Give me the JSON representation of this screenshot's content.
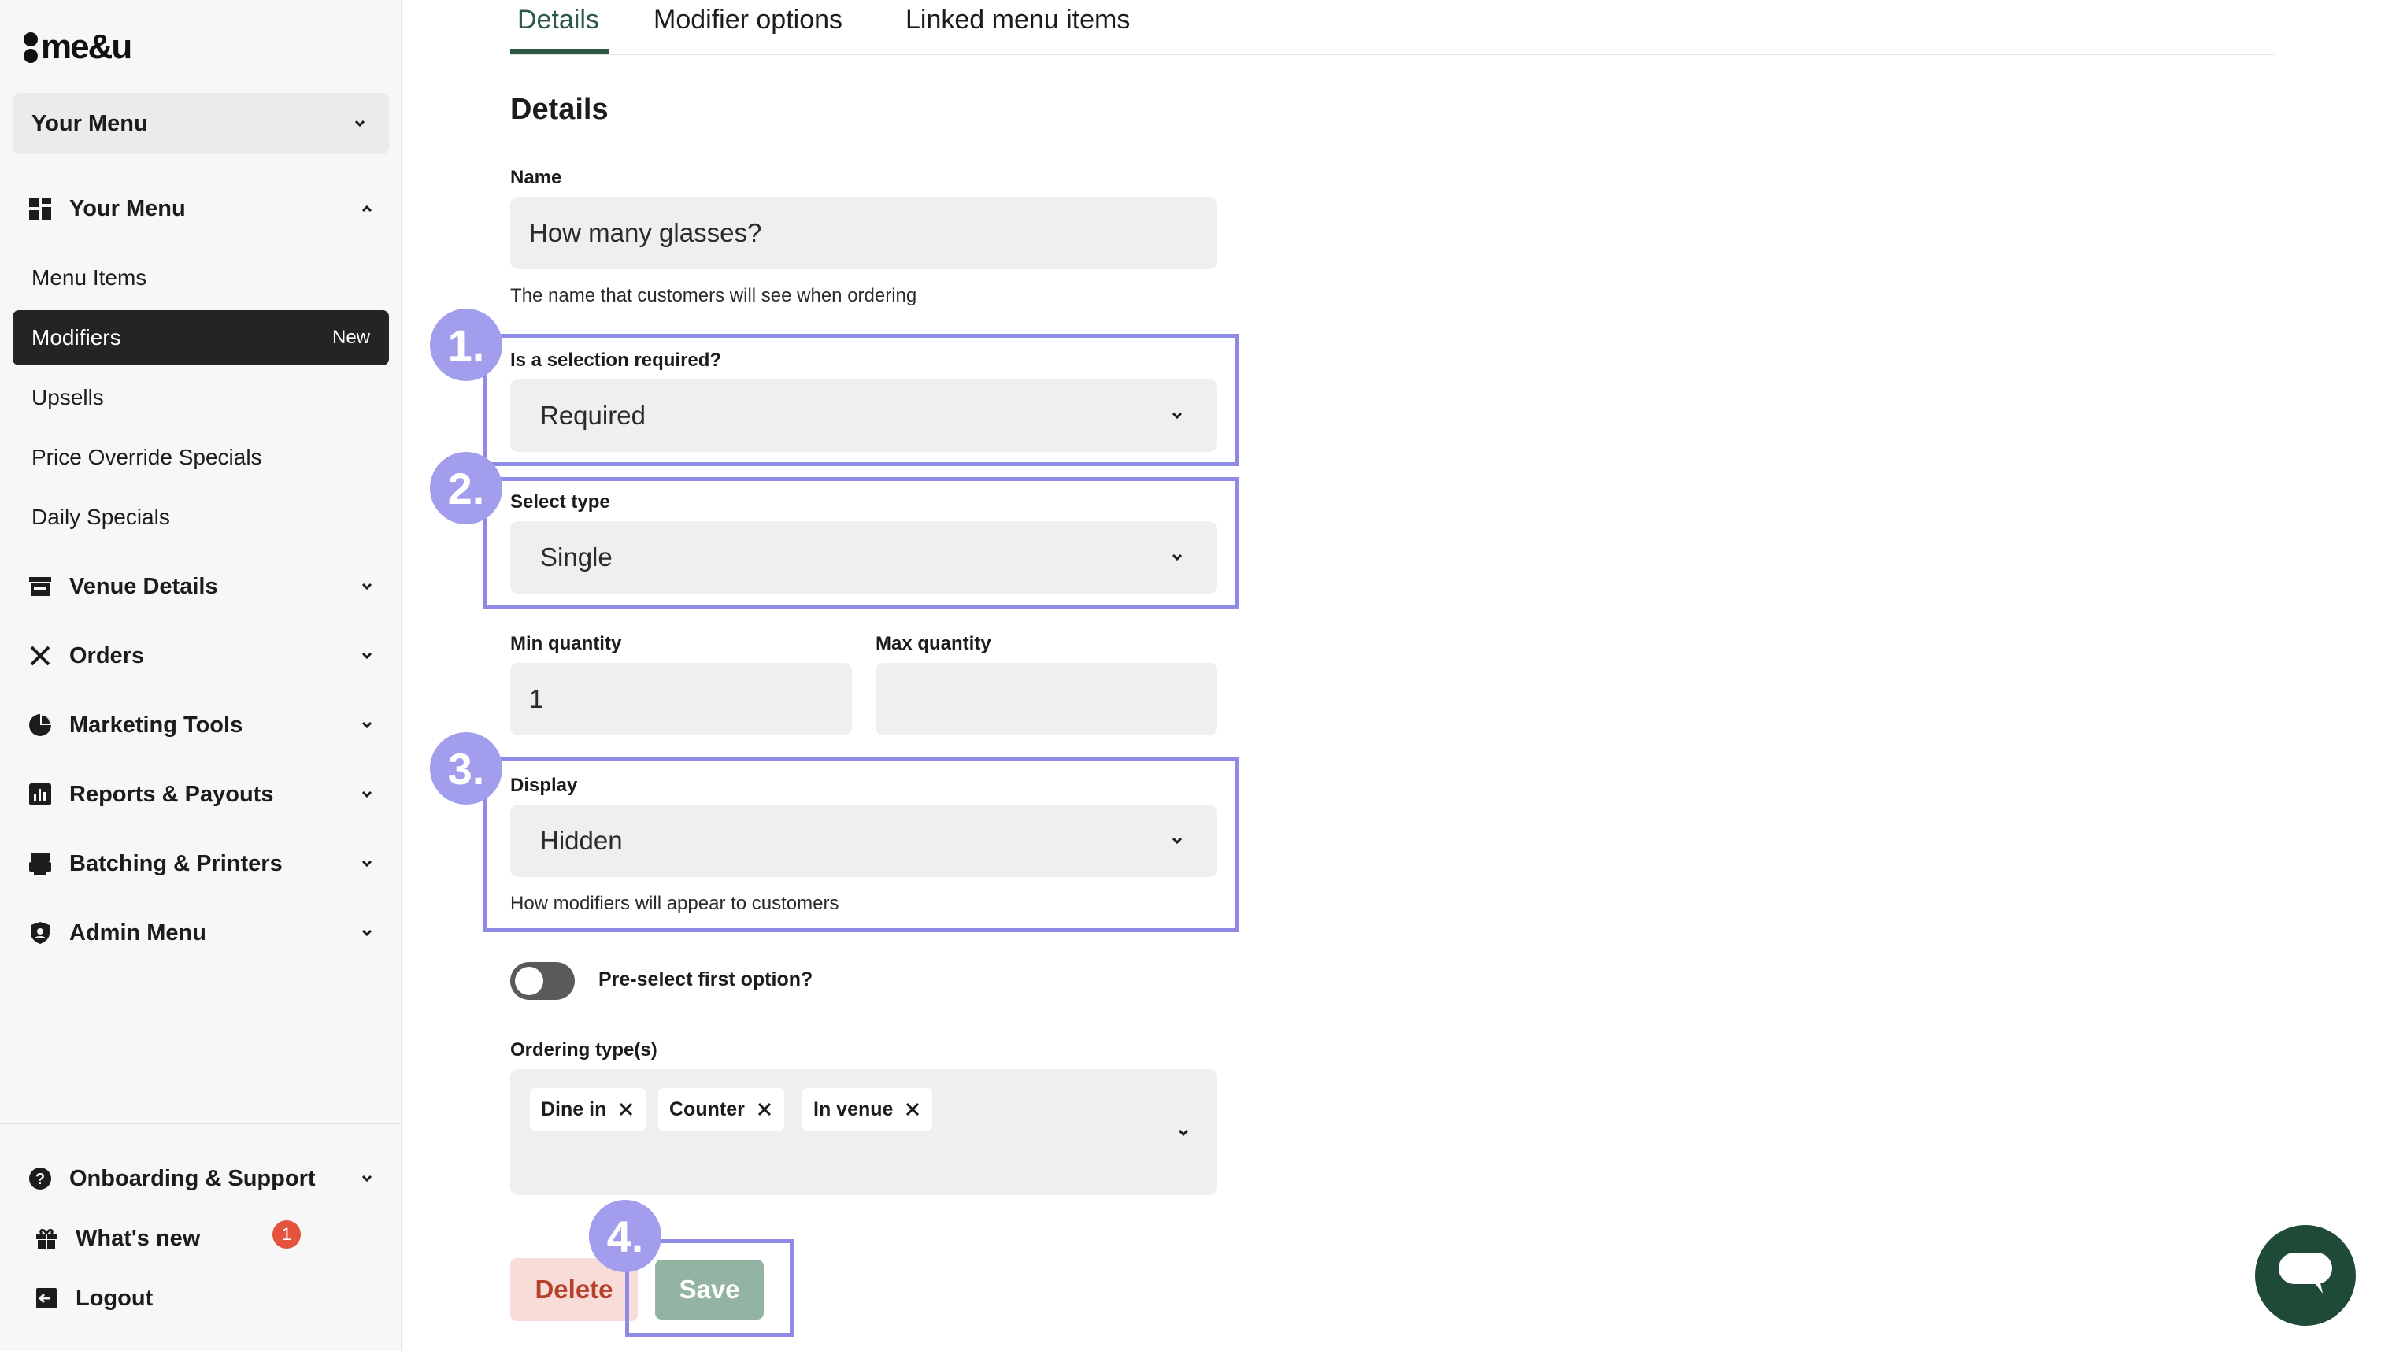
{
  "brand": {
    "logo_text": "me&u"
  },
  "sidebar": {
    "menu_select": "Your Menu",
    "groups": [
      {
        "label": "Your Menu",
        "icon": "grid-icon",
        "expanded": true
      },
      {
        "label": "Venue Details",
        "icon": "storefront-icon"
      },
      {
        "label": "Orders",
        "icon": "utensils-icon"
      },
      {
        "label": "Marketing Tools",
        "icon": "pie-chart-icon"
      },
      {
        "label": "Reports & Payouts",
        "icon": "bar-chart-icon"
      },
      {
        "label": "Batching & Printers",
        "icon": "printer-icon"
      },
      {
        "label": "Admin Menu",
        "icon": "shield-icon"
      }
    ],
    "sub_items": [
      {
        "label": "Menu Items"
      },
      {
        "label": "Modifiers",
        "badge": "New",
        "active": true
      },
      {
        "label": "Upsells"
      },
      {
        "label": "Price Override Specials"
      },
      {
        "label": "Daily Specials"
      }
    ],
    "footer": {
      "support": "Onboarding & Support",
      "whats_new": "What's new",
      "whats_new_count": "1",
      "logout": "Logout"
    }
  },
  "tabs": [
    {
      "label": "Details",
      "active": true
    },
    {
      "label": "Modifier options"
    },
    {
      "label": "Linked menu items"
    }
  ],
  "form": {
    "section_title": "Details",
    "name": {
      "label": "Name",
      "value": "How many glasses?",
      "helper": "The name that customers will see when ordering"
    },
    "selection_required": {
      "label": "Is a selection required?",
      "value": "Required"
    },
    "select_type": {
      "label": "Select type",
      "value": "Single"
    },
    "min_quantity": {
      "label": "Min quantity",
      "value": "1"
    },
    "max_quantity": {
      "label": "Max quantity",
      "value": ""
    },
    "display": {
      "label": "Display",
      "value": "Hidden",
      "helper": "How modifiers will appear to customers"
    },
    "preselect": {
      "label": "Pre-select first option?",
      "on": false
    },
    "ordering_types": {
      "label": "Ordering type(s)",
      "chips": [
        "Dine in",
        "Counter",
        "In venue"
      ]
    }
  },
  "actions": {
    "delete": "Delete",
    "save": "Save"
  },
  "annotations": {
    "steps": [
      "1.",
      "2.",
      "3.",
      "4."
    ]
  },
  "colors": {
    "accent": "#2d5a45",
    "highlight": "#8f8ae6",
    "step_badge": "#a29ded",
    "delete_bg": "#f8dcd8",
    "delete_text": "#b5412c",
    "save_bg": "#94b4a3",
    "chat_bg": "#1f4a37",
    "notif": "#e5533d"
  }
}
